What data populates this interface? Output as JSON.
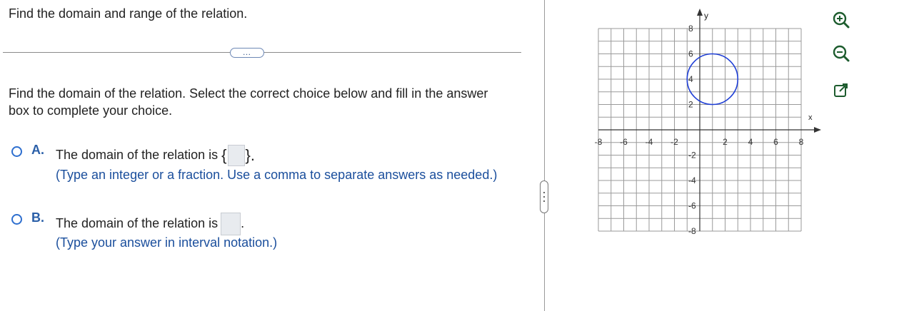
{
  "question": {
    "title": "Find the domain and range of the relation.",
    "more_label": "…",
    "instruction": "Find the domain of the relation. Select the correct choice below and fill in the answer box to complete your choice."
  },
  "choices": [
    {
      "letter": "A.",
      "text": "The domain of the relation is",
      "brace_open": "{",
      "brace_close": "}.",
      "hint": "(Type an integer or a fraction. Use a comma to separate answers as needed.)"
    },
    {
      "letter": "B.",
      "text": "The domain of the relation is",
      "suffix": ".",
      "hint": "(Type your answer in interval notation.)"
    }
  ],
  "graph": {
    "x_axis_label": "x",
    "y_axis_label": "y",
    "x_ticks": [
      "-8",
      "-6",
      "-4",
      "-2",
      "2",
      "4",
      "6",
      "8"
    ],
    "y_ticks": [
      "8",
      "6",
      "4",
      "2",
      "-2",
      "-4",
      "-6",
      "-8"
    ],
    "circle": {
      "center_x": 1,
      "center_y": 4,
      "radius": 2
    },
    "circle_color": "#1f3fd6"
  },
  "tools": {
    "zoom_in": "zoom-in-icon",
    "zoom_out": "zoom-out-icon",
    "popout": "popout-icon"
  }
}
